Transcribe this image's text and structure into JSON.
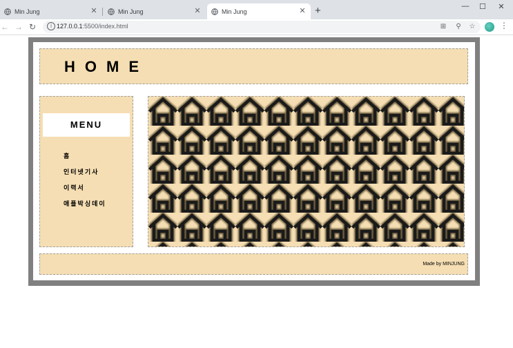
{
  "browser": {
    "tabs": [
      {
        "title": "Min Jung",
        "active": false
      },
      {
        "title": "Min Jung",
        "active": false
      },
      {
        "title": "Min Jung",
        "active": true
      }
    ],
    "url_host": "127.0.0.1",
    "url_path": ":5500/index.html"
  },
  "page": {
    "header": {
      "title": "HOME"
    },
    "sidebar": {
      "menu_title": "MENU",
      "items": [
        {
          "label": "홈"
        },
        {
          "label": "인터넷기사"
        },
        {
          "label": "이력서"
        },
        {
          "label": "애플박싱데이"
        }
      ]
    },
    "content": {
      "pattern_icon": "house-icon"
    },
    "footer": {
      "text": "Made by MINJUNG"
    }
  },
  "colors": {
    "panel": "#f5deb3",
    "frame": "#808080"
  }
}
